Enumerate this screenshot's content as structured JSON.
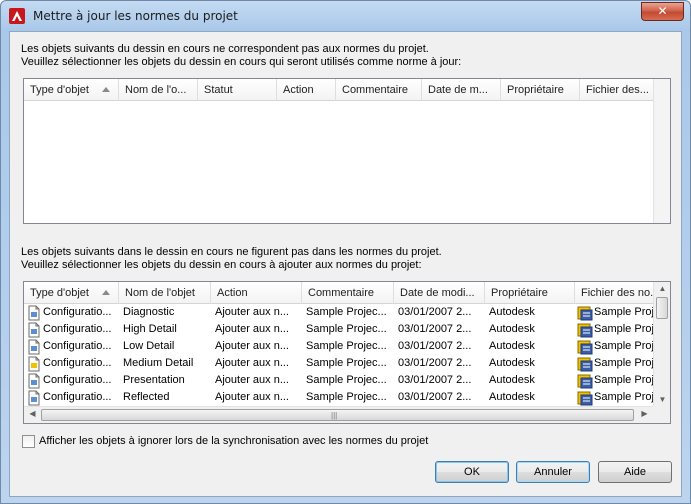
{
  "window": {
    "title": "Mettre à jour les normes du projet",
    "close_label": "✕"
  },
  "section1": {
    "line1": "Les objets suivants du dessin en cours ne correspondent pas aux normes du projet.",
    "line2": "Veuillez sélectionner les objets du dessin en cours qui seront utilisés comme norme à jour:",
    "columns": [
      "Type d'objet",
      "Nom de l'o...",
      "Statut",
      "Action",
      "Commentaire",
      "Date de m...",
      "Propriétaire",
      "Fichier des..."
    ]
  },
  "section2": {
    "line1": "Les objets suivants dans le dessin en cours ne figurent pas dans les normes du projet.",
    "line2": "Veuillez sélectionner les objets du dessin en cours à ajouter aux normes du projet:",
    "columns": [
      "Type d'objet",
      "Nom de l'objet",
      "Action",
      "Commentaire",
      "Date de modi...",
      "Propriétaire",
      "Fichier des no..."
    ],
    "rows": [
      {
        "type": "Configuratio...",
        "name": "Diagnostic",
        "action": "Ajouter aux n...",
        "comment": "Sample Projec...",
        "date": "03/01/2007 2...",
        "owner": "Autodesk",
        "file": "Sample Proj"
      },
      {
        "type": "Configuratio...",
        "name": "High Detail",
        "action": "Ajouter aux n...",
        "comment": "Sample Projec...",
        "date": "03/01/2007 2...",
        "owner": "Autodesk",
        "file": "Sample Proj"
      },
      {
        "type": "Configuratio...",
        "name": "Low Detail",
        "action": "Ajouter aux n...",
        "comment": "Sample Projec...",
        "date": "03/01/2007 2...",
        "owner": "Autodesk",
        "file": "Sample Proj"
      },
      {
        "type": "Configuratio...",
        "name": "Medium Detail",
        "action": "Ajouter aux n...",
        "comment": "Sample Projec...",
        "date": "03/01/2007 2...",
        "owner": "Autodesk",
        "file": "Sample Proj"
      },
      {
        "type": "Configuratio...",
        "name": "Presentation",
        "action": "Ajouter aux n...",
        "comment": "Sample Projec...",
        "date": "03/01/2007 2...",
        "owner": "Autodesk",
        "file": "Sample Proj"
      },
      {
        "type": "Configuratio...",
        "name": "Reflected",
        "action": "Ajouter aux n...",
        "comment": "Sample Projec...",
        "date": "03/01/2007 2...",
        "owner": "Autodesk",
        "file": "Sample Proj"
      }
    ]
  },
  "options": {
    "show_ignored_label": "Afficher les objets à ignorer lors de la synchronisation avec les normes du projet",
    "show_ignored_checked": false
  },
  "buttons": {
    "ok": "OK",
    "cancel": "Annuler",
    "help": "Aide"
  },
  "colors": {
    "accent_red": "#c8161d",
    "icon_yellow": "#f2c200"
  }
}
